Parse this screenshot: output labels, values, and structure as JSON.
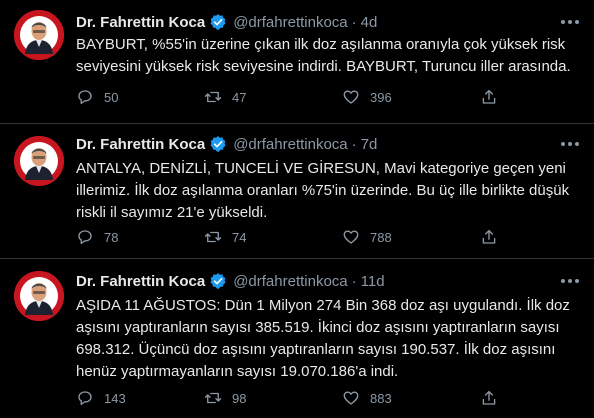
{
  "colors": {
    "background": "#000000",
    "text": "#e7e9ea",
    "muted": "#8b98a5",
    "divider": "#2f3336",
    "verified": "#1d9bf0",
    "avatar_bg": "#c7161f"
  },
  "tweets": [
    {
      "author": "Dr. Fahrettin Koca",
      "handle": "@drfahrettinkoca",
      "separator": "·",
      "time": "4d",
      "lines": [
        "BAYBURT, %55'in üzerine çıkan ilk doz aşılanma oranıyla çok yüksek risk",
        "seviyesini yüksek risk seviyesine indirdi. BAYBURT, Turuncu iller arasında."
      ],
      "replies": "50",
      "retweets": "47",
      "likes": "396"
    },
    {
      "author": "Dr. Fahrettin Koca",
      "handle": "@drfahrettinkoca",
      "separator": "·",
      "time": "7d",
      "lines": [
        "ANTALYA, DENİZLİ, TUNCELİ VE GİRESUN, Mavi kategoriye geçen yeni",
        "illerimiz. İlk doz aşılanma oranları %75'in üzerinde. Bu üç ille birlikte düşük",
        "riskli il sayımız 21'e yükseldi."
      ],
      "replies": "78",
      "retweets": "74",
      "likes": "788"
    },
    {
      "author": "Dr. Fahrettin Koca",
      "handle": "@drfahrettinkoca",
      "separator": "·",
      "time": "11d",
      "lines": [
        "AŞIDA 11 AĞUSTOS: Dün 1 Milyon 274 Bin 368 doz aşı uygulandı. İlk doz",
        "aşısını yaptıranların sayısı 385.519. İkinci doz aşısını yaptıranların sayısı",
        "698.312. Üçüncü doz aşısını yaptıranların sayısı 190.537. İlk doz aşısını",
        "henüz yaptırmayanların sayısı 19.070.186'a indi."
      ],
      "replies": "143",
      "retweets": "98",
      "likes": "883"
    }
  ]
}
